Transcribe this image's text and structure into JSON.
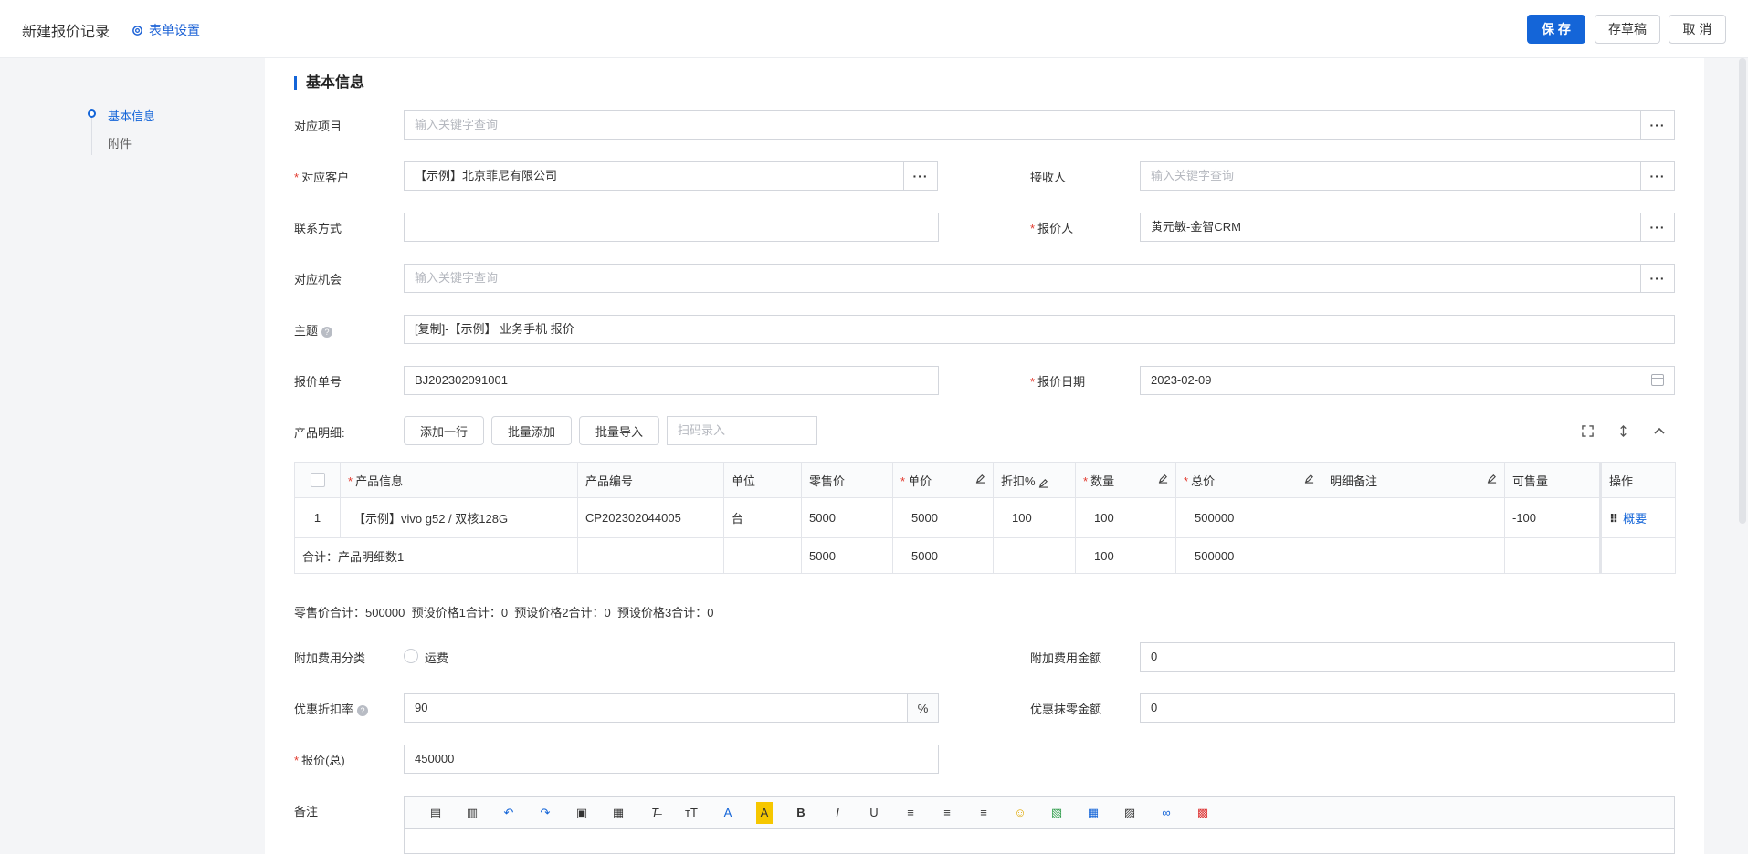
{
  "header": {
    "title": "新建报价记录",
    "form_settings": "表单设置",
    "save": "保 存",
    "draft": "存草稿",
    "cancel": "取 消"
  },
  "nav": {
    "items": [
      "基本信息",
      "附件"
    ],
    "active_index": 0
  },
  "section_title": "基本信息",
  "fields": {
    "project": {
      "label": "对应项目",
      "placeholder": "输入关键字查询"
    },
    "customer": {
      "label": "对应客户",
      "value": "【示例】北京菲尼有限公司"
    },
    "receiver": {
      "label": "接收人",
      "placeholder": "输入关键字查询"
    },
    "contact": {
      "label": "联系方式",
      "value": ""
    },
    "quoter": {
      "label": "报价人",
      "value": "黄元敏-金智CRM"
    },
    "opportunity": {
      "label": "对应机会",
      "placeholder": "输入关键字查询"
    },
    "subject": {
      "label": "主题",
      "value": "[复制]-【示例】 业务手机 报价"
    },
    "quote_no": {
      "label": "报价单号",
      "value": "BJ202302091001"
    },
    "quote_date": {
      "label": "报价日期",
      "value": "2023-02-09"
    }
  },
  "products": {
    "label": "产品明细:",
    "add_row": "添加一行",
    "batch_add": "批量添加",
    "batch_import": "批量导入",
    "scan_placeholder": "扫码录入",
    "columns": [
      "产品信息",
      "产品编号",
      "单位",
      "零售价",
      "单价",
      "折扣%",
      "数量",
      "总价",
      "明细备注",
      "可售量",
      "操作"
    ],
    "rows": [
      {
        "index": "1",
        "product": "【示例】vivo g52 / 双核128G",
        "code": "CP202302044005",
        "unit": "台",
        "retail": "5000",
        "price": "5000",
        "discount": "100",
        "qty": "100",
        "total": "500000",
        "note": "",
        "available": "-100",
        "action": "概要"
      }
    ],
    "total_row": {
      "label": "合计：产品明细数1",
      "retail": "5000",
      "price": "5000",
      "qty": "100",
      "total": "500000"
    }
  },
  "summary_line": "零售价合计：500000  预设价格1合计：0  预设价格2合计：0  预设价格3合计：0",
  "extra": {
    "fee_category": {
      "label": "附加费用分类",
      "option": "运费"
    },
    "fee_amount": {
      "label": "附加费用金额",
      "value": "0"
    },
    "discount_rate": {
      "label": "优惠折扣率",
      "value": "90",
      "suffix": "%"
    },
    "round_amount": {
      "label": "优惠抹零金额",
      "value": "0"
    },
    "quote_total": {
      "label": "报价(总)",
      "value": "450000"
    },
    "remark": {
      "label": "备注"
    }
  },
  "editor_tools": [
    "source-icon",
    "template-icon",
    "undo-icon",
    "redo-icon",
    "paste-icon",
    "paste-text-icon",
    "clear-format-icon",
    "font-size-icon",
    "font-color-icon",
    "highlight-icon",
    "bold-icon",
    "italic-icon",
    "underline-icon",
    "align-left-icon",
    "align-center-icon",
    "align-right-icon",
    "emoji-icon",
    "insert-image-icon",
    "table-icon",
    "media-icon",
    "link-icon",
    "map-icon"
  ],
  "colors": {
    "primary": "#1465d8",
    "required": "#e23a2e"
  }
}
